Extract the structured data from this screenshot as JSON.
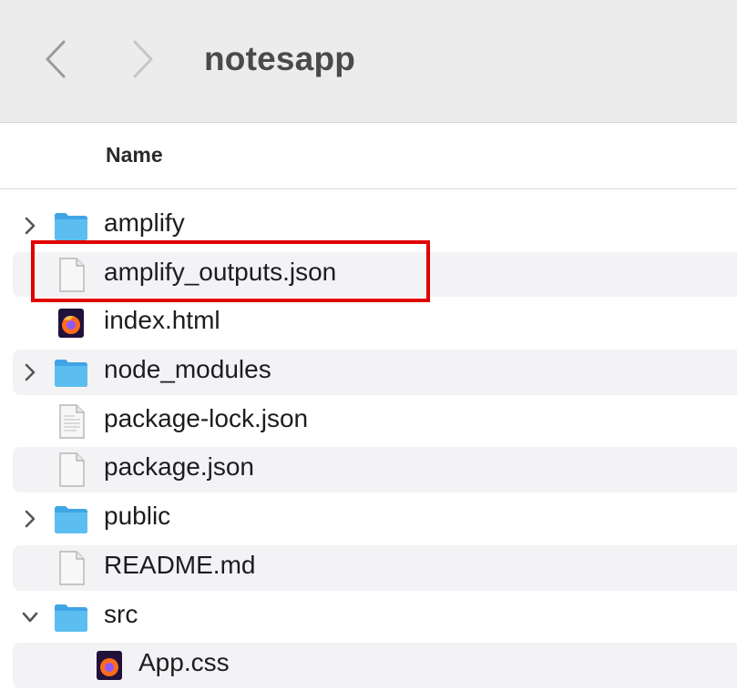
{
  "toolbar": {
    "title": "notesapp",
    "back_icon": "chevron-left-icon",
    "forward_icon": "chevron-right-icon"
  },
  "columns": {
    "name": "Name"
  },
  "files": [
    {
      "label": "amplify",
      "kind": "folder",
      "expanded": false
    },
    {
      "label": "amplify_outputs.json",
      "kind": "json-file",
      "highlighted": true
    },
    {
      "label": "index.html",
      "kind": "html-file"
    },
    {
      "label": "node_modules",
      "kind": "folder",
      "expanded": false
    },
    {
      "label": "package-lock.json",
      "kind": "text-file"
    },
    {
      "label": "package.json",
      "kind": "json-file"
    },
    {
      "label": "public",
      "kind": "folder",
      "expanded": false
    },
    {
      "label": "README.md",
      "kind": "markdown-file"
    },
    {
      "label": "src",
      "kind": "folder",
      "expanded": true
    },
    {
      "label": "App.css",
      "kind": "css-file",
      "indent": 1
    }
  ],
  "colors": {
    "folder": "#4fb3ec",
    "highlight_border": "#e00000",
    "stripe": "#f3f3f5"
  }
}
